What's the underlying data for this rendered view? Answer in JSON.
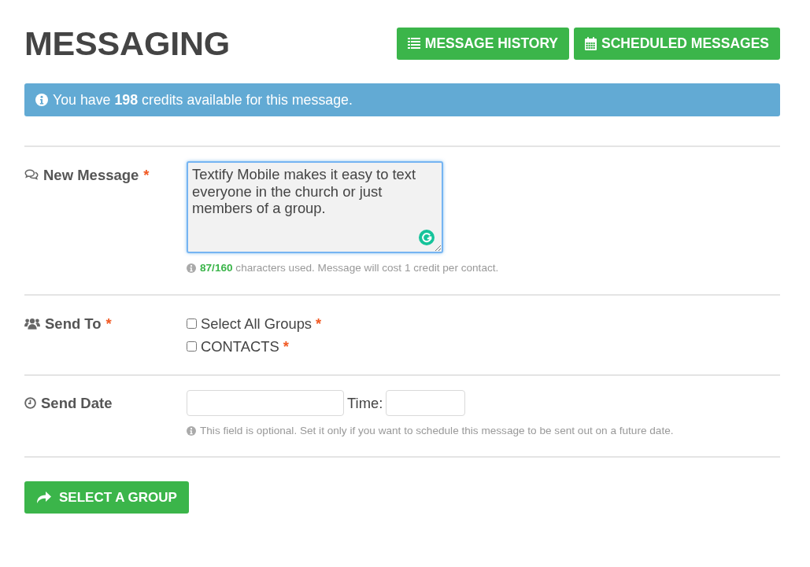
{
  "header": {
    "title": "MESSAGING",
    "buttons": [
      {
        "label": "MESSAGE HISTORY"
      },
      {
        "label": "SCHEDULED MESSAGES"
      }
    ]
  },
  "alert": {
    "text": "You have **198** credits available for this message."
  },
  "form": {
    "fields": [
      {
        "kind": "message",
        "label": "New Message",
        "required_mark": "*",
        "value": "Textify Mobile makes it easy to text everyone in the church or just members of a group.",
        "focused": true,
        "help": "**87/160** characters used. Message will cost 1 credit per contact."
      },
      {
        "kind": "recipients",
        "label": "Send To",
        "required_mark": "*",
        "options": [
          {
            "label": "Select All Groups",
            "required_mark": "*",
            "checked": false
          },
          {
            "label": "CONTACTS",
            "required_mark": "*",
            "checked": false
          }
        ]
      },
      {
        "kind": "schedule",
        "label": "Send Date",
        "time_label": "Time:",
        "help": "This field is optional. Set it only if you want to schedule this message to be sent out on a future date."
      }
    ]
  },
  "submit": {
    "label": "SELECT A GROUP"
  }
}
